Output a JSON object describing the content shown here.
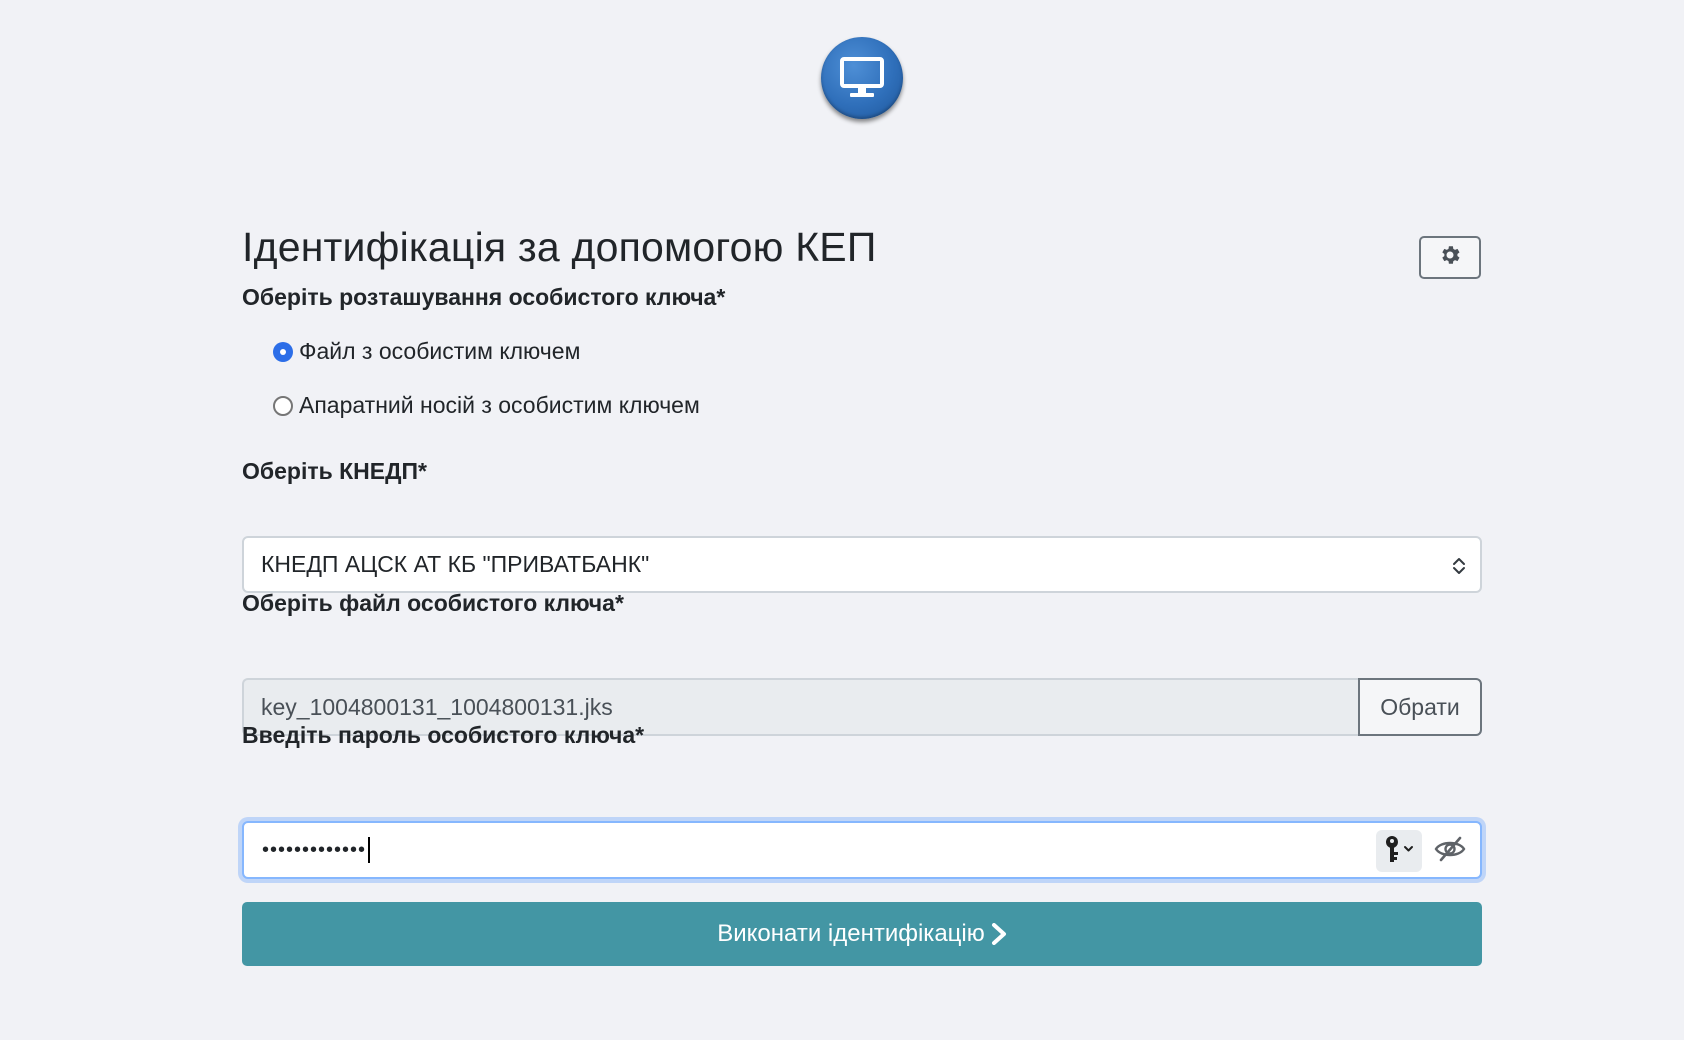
{
  "header": {
    "logo_icon": "monitor-icon"
  },
  "form": {
    "title": "Ідентифікація за допомогою КЕП",
    "settings_icon": "gear-icon",
    "key_location": {
      "label": "Оберіть розташування особистого ключа*",
      "options": [
        {
          "label": "Файл з особистим ключем",
          "checked": true
        },
        {
          "label": "Апаратний носій з особистим ключем",
          "checked": false
        }
      ]
    },
    "kep_provider": {
      "label": "Оберіть КНЕДП*",
      "selected": "КНЕДП АЦСК АТ КБ \"ПРИВАТБАНК\""
    },
    "key_file": {
      "label": "Оберіть файл особистого ключа*",
      "value": "key_1004800131_1004800131.jks",
      "button_label": "Обрати"
    },
    "password": {
      "label": "Введіть пароль особистого ключа*",
      "masked_value": "•••••••••••••"
    },
    "submit_label": "Виконати ідентифікацію"
  },
  "colors": {
    "background": "#f1f2f6",
    "primary": "#4396a4",
    "radio_checked": "#2c6ee8",
    "logo": "#2f6fba"
  }
}
